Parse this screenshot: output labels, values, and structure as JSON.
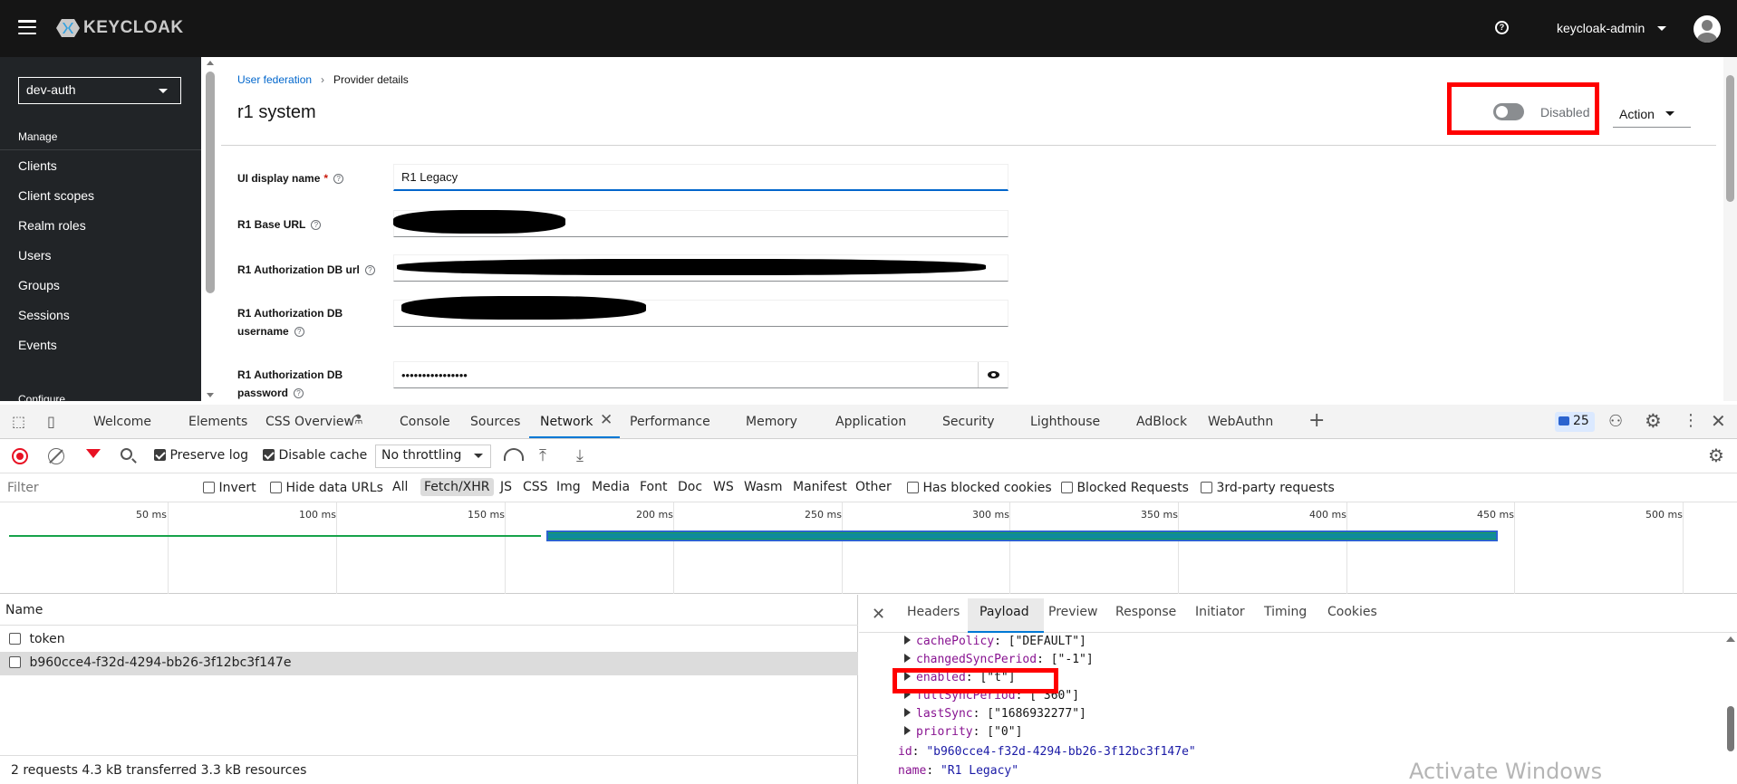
{
  "header": {
    "logo_text": "KEYCLOAK",
    "user_name": "keycloak-admin"
  },
  "sidebar": {
    "realm": "dev-auth",
    "manage_heading": "Manage",
    "items": [
      "Clients",
      "Client scopes",
      "Realm roles",
      "Users",
      "Groups",
      "Sessions",
      "Events"
    ],
    "configure_heading": "Configure"
  },
  "main": {
    "breadcrumb": {
      "parent": "User federation",
      "current": "Provider details"
    },
    "title": "r1 system",
    "toggle_label": "Disabled",
    "action_label": "Action",
    "fields": [
      {
        "label": "UI display name",
        "required": "*",
        "value": "R1 Legacy"
      },
      {
        "label": "R1 Base URL",
        "value": ""
      },
      {
        "label": "R1 Authorization DB url",
        "value": ""
      },
      {
        "label_line1": "R1 Authorization DB",
        "label_line2": "username",
        "value": ""
      },
      {
        "label_line1": "R1 Authorization DB",
        "label_line2": "password",
        "value": "••••••••••••••••"
      }
    ]
  },
  "devtools": {
    "tabs": [
      "Welcome",
      "Elements",
      "CSS Overview",
      "Console",
      "Sources",
      "Network",
      "Performance",
      "Memory",
      "Application",
      "Security",
      "Lighthouse",
      "AdBlock",
      "WebAuthn"
    ],
    "issues_count": "25",
    "toolbar": {
      "preserve_log": "Preserve log",
      "disable_cache": "Disable cache",
      "throttling": "No throttling"
    },
    "filter": {
      "placeholder": "Filter",
      "invert": "Invert",
      "hide_data_urls": "Hide data URLs",
      "types": [
        "All",
        "Fetch/XHR",
        "JS",
        "CSS",
        "Img",
        "Media",
        "Font",
        "Doc",
        "WS",
        "Wasm",
        "Manifest",
        "Other"
      ],
      "blocked_cookies": "Has blocked cookies",
      "blocked_requests": "Blocked Requests",
      "third_party": "3rd-party requests"
    },
    "timeline_ticks": [
      "50 ms",
      "100 ms",
      "150 ms",
      "200 ms",
      "250 ms",
      "300 ms",
      "350 ms",
      "400 ms",
      "450 ms",
      "500 ms"
    ],
    "requests": {
      "header": "Name",
      "rows": [
        "token",
        "b960cce4-f32d-4294-bb26-3f12bc3f147e"
      ],
      "status": "2 requests  4.3 kB transferred  3.3 kB resources"
    },
    "detail_tabs": [
      "Headers",
      "Payload",
      "Preview",
      "Response",
      "Initiator",
      "Timing",
      "Cookies"
    ],
    "payload": [
      {
        "key": "cachePolicy",
        "value": "[\"DEFAULT\"]"
      },
      {
        "key": "changedSyncPeriod",
        "value": "[\"-1\"]"
      },
      {
        "key": "enabled",
        "value": "[\"t\"]"
      },
      {
        "key": "fullSyncPeriod",
        "value": "[\"360\"]"
      },
      {
        "key": "lastSync",
        "value": "[\"1686932277\"]"
      },
      {
        "key": "priority",
        "value": "[\"0\"]"
      }
    ],
    "payload_id": {
      "key": "id",
      "value": "\"b960cce4-f32d-4294-bb26-3f12bc3f147e\""
    },
    "payload_name": {
      "key": "name",
      "value": "\"R1 Legacy\""
    }
  },
  "watermark": "Activate Windows"
}
